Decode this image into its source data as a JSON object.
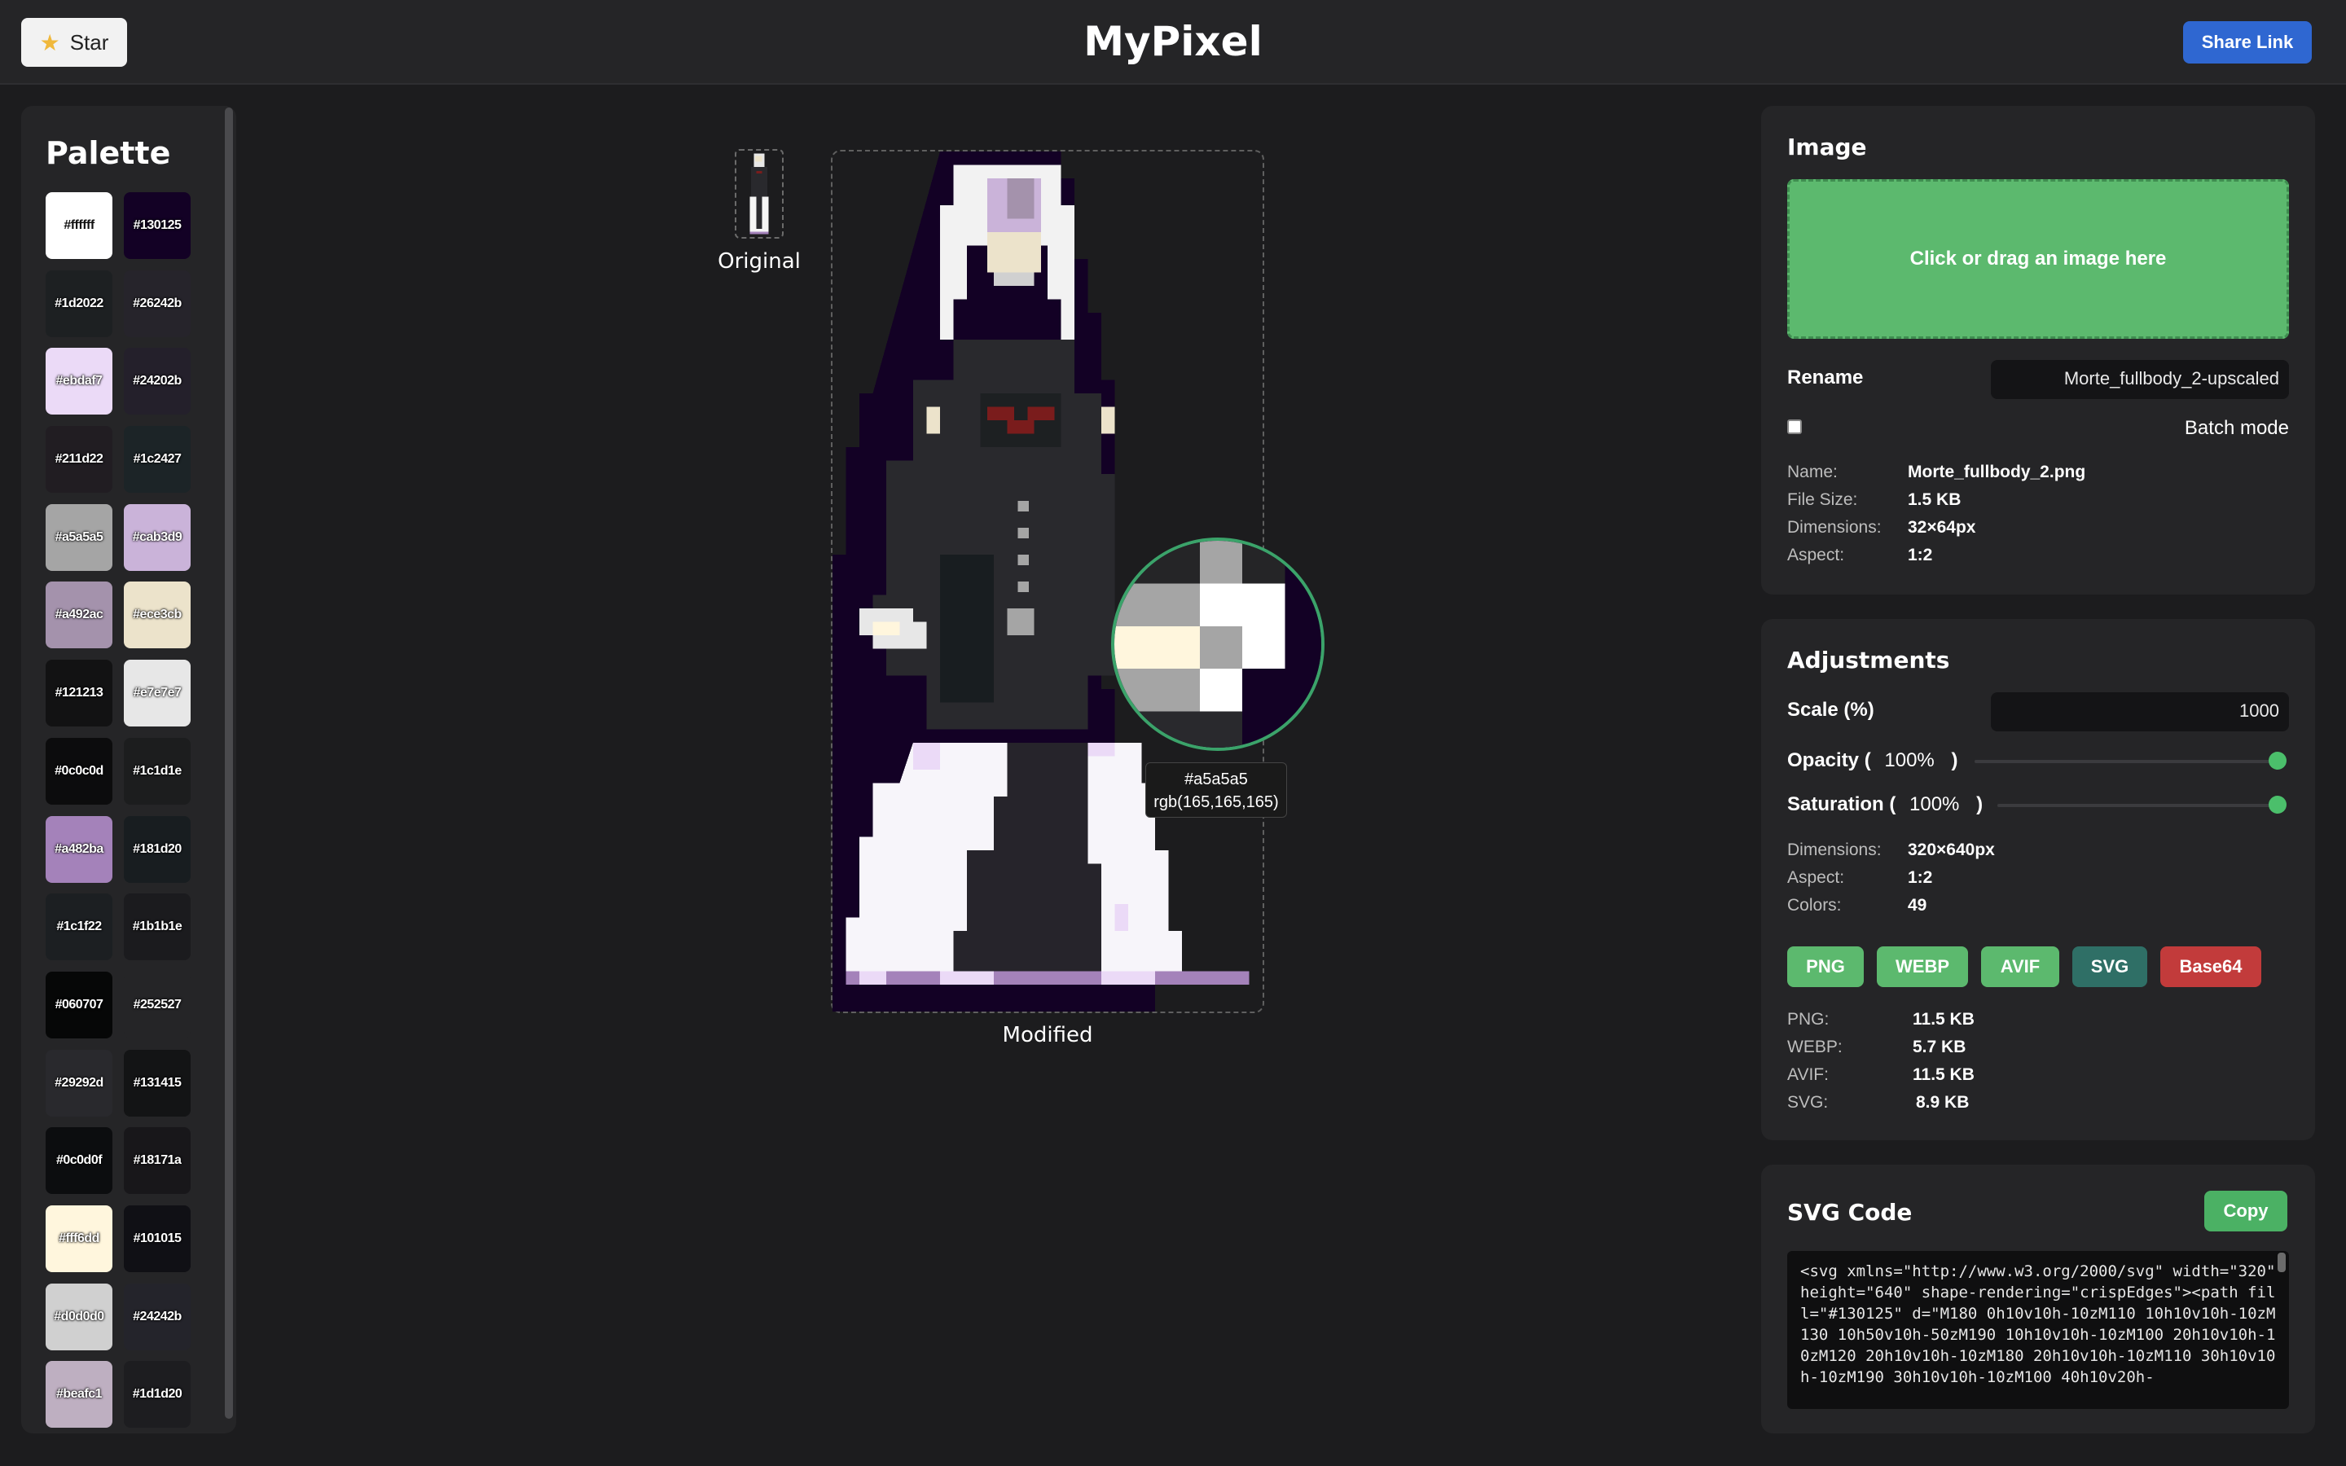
{
  "header": {
    "star_label": "Star",
    "title": "MyPixel",
    "share_label": "Share Link"
  },
  "palette": {
    "title": "Palette",
    "swatches": [
      "#ffffff",
      "#130125",
      "#1d2022",
      "#26242b",
      "#ebdaf7",
      "#24202b",
      "#211d22",
      "#1c2427",
      "#a5a5a5",
      "#cab3d9",
      "#a492ac",
      "#ece3cb",
      "#121213",
      "#e7e7e7",
      "#0c0c0d",
      "#1c1d1e",
      "#a482ba",
      "#181d20",
      "#1c1f22",
      "#1b1b1e",
      "#060707",
      "#252527",
      "#29292d",
      "#131415",
      "#0c0d0f",
      "#18171a",
      "#fff6dd",
      "#101015",
      "#d0d0d0",
      "#24242b",
      "#beafc1",
      "#1d1d20"
    ]
  },
  "preview": {
    "original_label": "Original",
    "modified_label": "Modified",
    "hover_hex": "#a5a5a5",
    "hover_rgb": "rgb(165,165,165)"
  },
  "image_panel": {
    "title": "Image",
    "dropzone_text": "Click or drag an image here",
    "rename_label": "Rename",
    "rename_value": "Morte_fullbody_2-upscaled",
    "batch_label": "Batch mode",
    "info": {
      "name_k": "Name:",
      "name_v": "Morte_fullbody_2.png",
      "size_k": "File Size:",
      "size_v": "1.5 KB",
      "dims_k": "Dimensions:",
      "dims_v": "32×64px",
      "aspect_k": "Aspect:",
      "aspect_v": "1:2"
    }
  },
  "adjustments": {
    "title": "Adjustments",
    "scale_label": "Scale (%)",
    "scale_value": "1000",
    "opacity_label": "Opacity (",
    "opacity_value": "100%",
    "opacity_close": ")",
    "saturation_label": "Saturation (",
    "saturation_value": "100%",
    "saturation_close": ")",
    "opacity_level": 1.0,
    "saturation_level": 1.0,
    "info": {
      "dims_k": "Dimensions:",
      "dims_v": "320×640px",
      "aspect_k": "Aspect:",
      "aspect_v": "1:2",
      "colors_k": "Colors:",
      "colors_v": "49"
    },
    "formats": [
      "PNG",
      "WEBP",
      "AVIF",
      "SVG",
      "Base64"
    ],
    "format_colors": [
      "#5cb96e",
      "#5cb96e",
      "#5cb96e",
      "#2f6f66",
      "#c23b3b"
    ],
    "sizes": {
      "png_k": "PNG:",
      "png_v": "11.5 KB",
      "webp_k": "WEBP:",
      "webp_v": "5.7 KB",
      "avif_k": "AVIF:",
      "avif_v": "11.5 KB",
      "svg_k": "SVG:",
      "svg_v": "8.9 KB"
    }
  },
  "svg_code": {
    "title": "SVG Code",
    "copy_label": "Copy",
    "code": "<svg xmlns=\"http://www.w3.org/2000/svg\" width=\"320\" height=\"640\" shape-rendering=\"crispEdges\"><path fill=\"#130125\" d=\"M180 0h10v10h-10zM110 10h10v10h-10zM130 10h50v10h-50zM190 10h10v10h-10zM100 20h10v10h-10zM120 20h10v10h-10zM180 20h10v10h-10zM110 30h10v10h-10zM190 30h10v10h-10zM100 40h10v20h-"
  }
}
